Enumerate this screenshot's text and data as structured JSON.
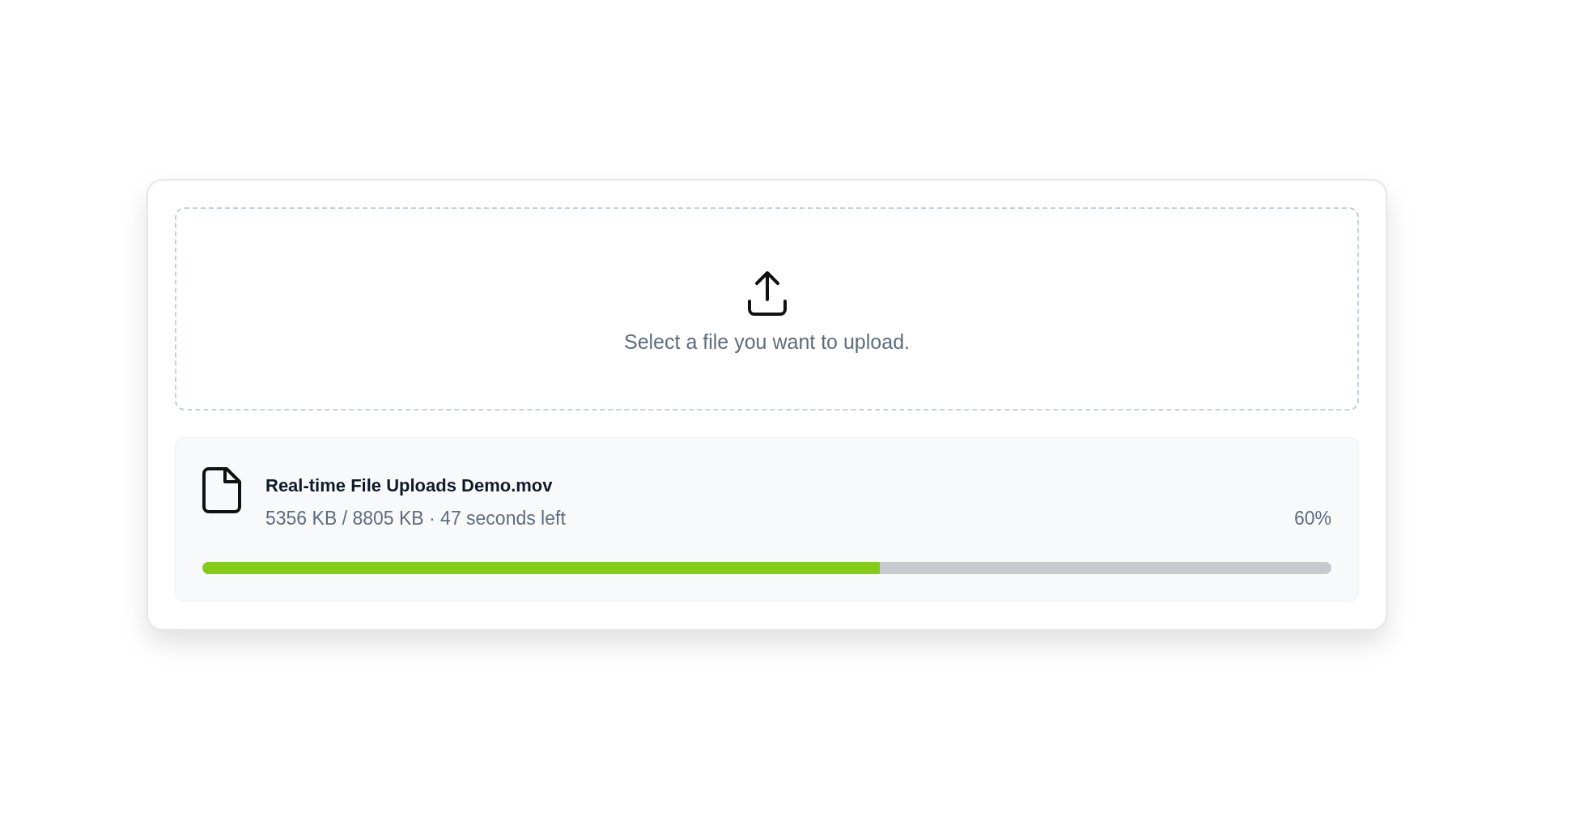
{
  "dropzone": {
    "prompt": "Select a file you want to upload."
  },
  "upload": {
    "filename": "Real-time File Uploads Demo.mov",
    "progress_text": "5356 KB / 8805 KB · 47 seconds left",
    "percent": "60%",
    "level": 0.6
  }
}
